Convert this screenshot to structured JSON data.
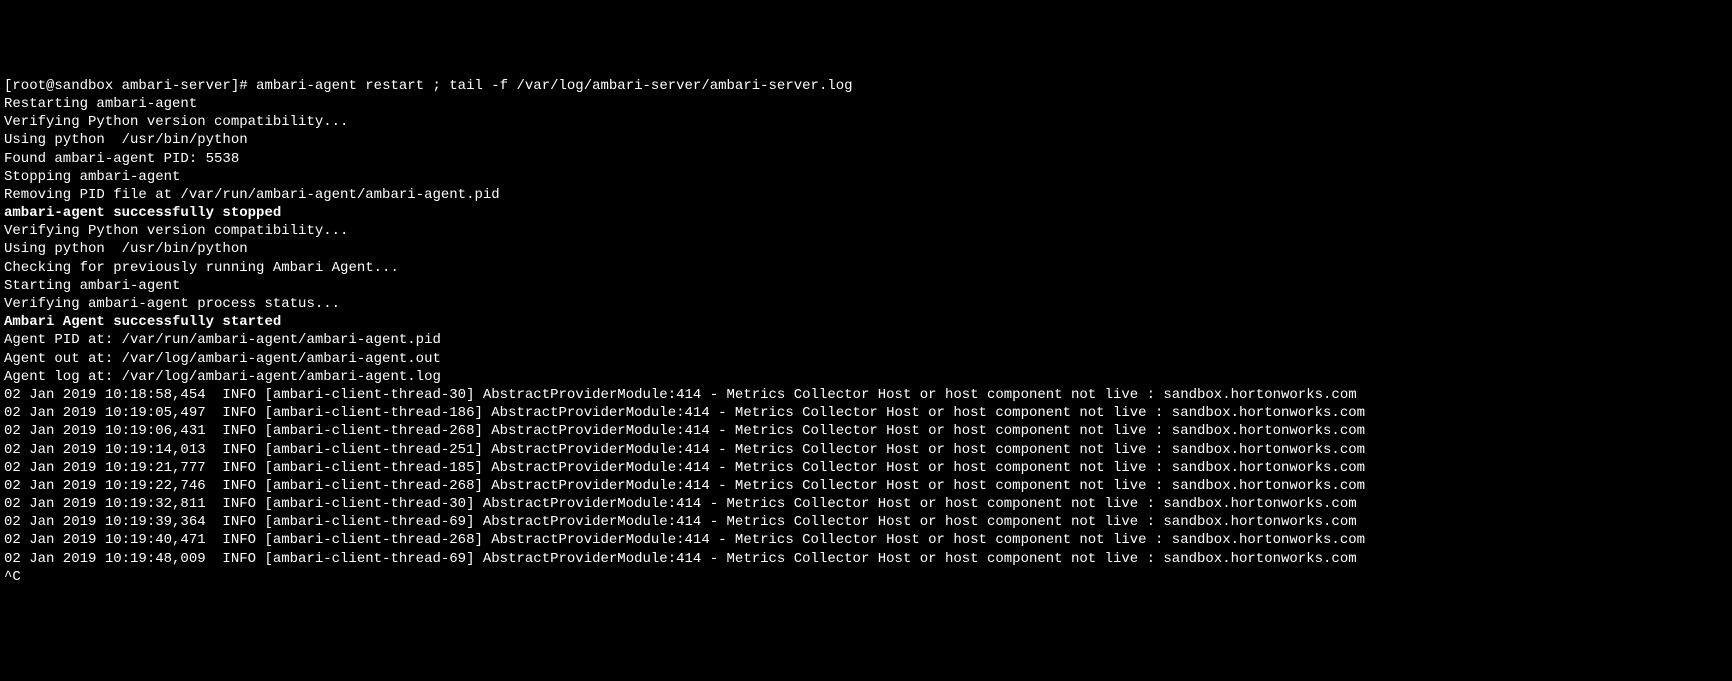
{
  "terminal": {
    "prompt": "[root@sandbox ambari-server]# ",
    "command": "ambari-agent restart ; tail -f /var/log/ambari-server/ambari-server.log",
    "lines": [
      {
        "text": "Restarting ambari-agent",
        "bold": false
      },
      {
        "text": "Verifying Python version compatibility...",
        "bold": false
      },
      {
        "text": "Using python  /usr/bin/python",
        "bold": false
      },
      {
        "text": "Found ambari-agent PID: 5538",
        "bold": false
      },
      {
        "text": "Stopping ambari-agent",
        "bold": false
      },
      {
        "text": "Removing PID file at /var/run/ambari-agent/ambari-agent.pid",
        "bold": false
      },
      {
        "text": "ambari-agent successfully stopped",
        "bold": true
      },
      {
        "text": "Verifying Python version compatibility...",
        "bold": false
      },
      {
        "text": "Using python  /usr/bin/python",
        "bold": false
      },
      {
        "text": "Checking for previously running Ambari Agent...",
        "bold": false
      },
      {
        "text": "Starting ambari-agent",
        "bold": false
      },
      {
        "text": "Verifying ambari-agent process status...",
        "bold": false
      },
      {
        "text": "Ambari Agent successfully started",
        "bold": true
      },
      {
        "text": "Agent PID at: /var/run/ambari-agent/ambari-agent.pid",
        "bold": false
      },
      {
        "text": "Agent out at: /var/log/ambari-agent/ambari-agent.out",
        "bold": false
      },
      {
        "text": "Agent log at: /var/log/ambari-agent/ambari-agent.log",
        "bold": false
      },
      {
        "text": "02 Jan 2019 10:18:58,454  INFO [ambari-client-thread-30] AbstractProviderModule:414 - Metrics Collector Host or host component not live : sandbox.hortonworks.com",
        "bold": false
      },
      {
        "text": "02 Jan 2019 10:19:05,497  INFO [ambari-client-thread-186] AbstractProviderModule:414 - Metrics Collector Host or host component not live : sandbox.hortonworks.com",
        "bold": false
      },
      {
        "text": "02 Jan 2019 10:19:06,431  INFO [ambari-client-thread-268] AbstractProviderModule:414 - Metrics Collector Host or host component not live : sandbox.hortonworks.com",
        "bold": false
      },
      {
        "text": "02 Jan 2019 10:19:14,013  INFO [ambari-client-thread-251] AbstractProviderModule:414 - Metrics Collector Host or host component not live : sandbox.hortonworks.com",
        "bold": false
      },
      {
        "text": "02 Jan 2019 10:19:21,777  INFO [ambari-client-thread-185] AbstractProviderModule:414 - Metrics Collector Host or host component not live : sandbox.hortonworks.com",
        "bold": false
      },
      {
        "text": "02 Jan 2019 10:19:22,746  INFO [ambari-client-thread-268] AbstractProviderModule:414 - Metrics Collector Host or host component not live : sandbox.hortonworks.com",
        "bold": false
      },
      {
        "text": "02 Jan 2019 10:19:32,811  INFO [ambari-client-thread-30] AbstractProviderModule:414 - Metrics Collector Host or host component not live : sandbox.hortonworks.com",
        "bold": false
      },
      {
        "text": "02 Jan 2019 10:19:39,364  INFO [ambari-client-thread-69] AbstractProviderModule:414 - Metrics Collector Host or host component not live : sandbox.hortonworks.com",
        "bold": false
      },
      {
        "text": "02 Jan 2019 10:19:40,471  INFO [ambari-client-thread-268] AbstractProviderModule:414 - Metrics Collector Host or host component not live : sandbox.hortonworks.com",
        "bold": false
      },
      {
        "text": "02 Jan 2019 10:19:48,009  INFO [ambari-client-thread-69] AbstractProviderModule:414 - Metrics Collector Host or host component not live : sandbox.hortonworks.com",
        "bold": false
      },
      {
        "text": "^C",
        "bold": false
      }
    ]
  }
}
